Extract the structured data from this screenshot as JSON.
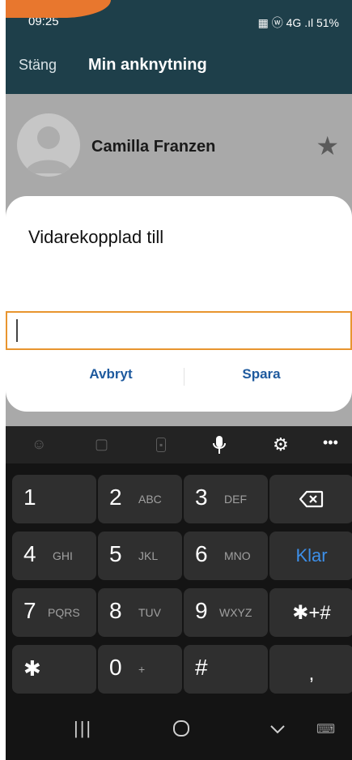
{
  "status_bar": {
    "time": "09:25",
    "right": "▦ ⓦ 4G .ıl 51%"
  },
  "toolbar": {
    "close_label": "Stäng",
    "title": "Min anknytning"
  },
  "contact": {
    "name": "Camilla Franzen"
  },
  "dialog": {
    "title": "Vidarekopplad till",
    "input_value": "",
    "cancel_label": "Avbryt",
    "save_label": "Spara"
  },
  "keyboard": {
    "keys": {
      "k1": {
        "num": "1",
        "letters": ""
      },
      "k2": {
        "num": "2",
        "letters": "ABC"
      },
      "k3": {
        "num": "3",
        "letters": "DEF"
      },
      "k4": {
        "num": "4",
        "letters": "GHI"
      },
      "k5": {
        "num": "5",
        "letters": "JKL"
      },
      "k6": {
        "num": "6",
        "letters": "MNO"
      },
      "k7": {
        "num": "7",
        "letters": "PQRS"
      },
      "k8": {
        "num": "8",
        "letters": "TUV"
      },
      "k9": {
        "num": "9",
        "letters": "WXYZ"
      },
      "k0": {
        "num": "0",
        "letters": "+"
      },
      "star": "✱",
      "hash": "#",
      "comma": ",",
      "symbols": "✱+#",
      "done": "Klar"
    }
  },
  "colors": {
    "header": "#1e3f4a",
    "accent_blue": "#1e5a9e",
    "input_border": "#e8952f",
    "key_blue": "#3d8fe8"
  }
}
